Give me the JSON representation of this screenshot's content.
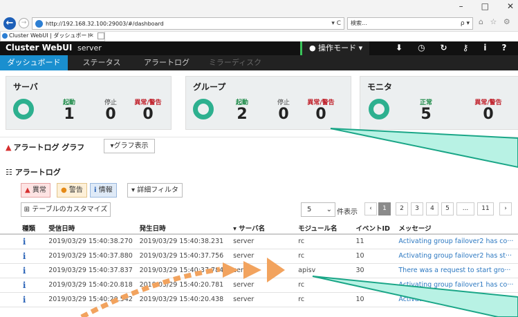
{
  "browser": {
    "url": "http://192.168.32.100:29003/#/dashboard",
    "search_placeholder": "検索...",
    "tab_title": "Cluster WebUI | ダッシュボード",
    "win_controls": [
      "–",
      "□",
      "✕"
    ],
    "refresh_glyph": "▾ C",
    "search_glyph": "ρ ▾",
    "tool_glyphs": "⌂ ☆ ⚙",
    "tab_close": "✕"
  },
  "app": {
    "title": "Cluster WebUI",
    "server": "server",
    "operation_mode": "操作モード ▾",
    "menu": [
      "ダッシュボード",
      "ステータス",
      "アラートログ",
      "ミラーディスク"
    ],
    "header_icons": [
      "download-icon",
      "clock-icon",
      "reload-icon",
      "key-icon",
      "info-icon",
      "help-icon",
      "list-icon"
    ],
    "header_icon_glyphs": [
      "⬇",
      "◷",
      "↻",
      "⚷",
      "i",
      "?",
      "☰"
    ]
  },
  "summary": {
    "server": {
      "title": "サーバ",
      "labels": [
        "起動",
        "停止",
        "異常/警告"
      ],
      "values": [
        "1",
        "0",
        "0"
      ]
    },
    "group": {
      "title": "グループ",
      "labels": [
        "起動",
        "停止",
        "異常/警告"
      ],
      "values": [
        "2",
        "0",
        "0"
      ]
    },
    "monitor": {
      "title": "モニタ",
      "labels": [
        "正常",
        "異常/警告"
      ],
      "values": [
        "5",
        "0"
      ]
    }
  },
  "graph": {
    "title": "アラートログ グラフ",
    "toggle": "▾グラフ表示",
    "warn_glyph": "▲"
  },
  "alertlog": {
    "title": "アラートログ",
    "title_glyph": "☷",
    "filters": [
      {
        "label": "異常",
        "glyph": "▲"
      },
      {
        "label": "警告",
        "glyph": "●"
      },
      {
        "label": "情報",
        "glyph": "i"
      }
    ],
    "detail_filter": "▾ 詳細フィルタ",
    "customize": "テーブルのカスタマイズ",
    "customize_glyph": "⊞",
    "page_size": "5",
    "page_size_glyph": "⌄",
    "page_size_suffix": "件表示",
    "pages": [
      "‹",
      "1",
      "2",
      "3",
      "4",
      "5",
      "...",
      "11",
      "›"
    ],
    "columns": [
      "種類",
      "受信日時",
      "発生日時",
      "▾ サーバ名",
      "モジュール名",
      "イベントID",
      "メッセージ"
    ],
    "rows": [
      {
        "kind": "i",
        "received": "2019/03/29 15:40:38.270",
        "occurred": "2019/03/29 15:40:38.231",
        "server": "server",
        "module": "rc",
        "event": "11",
        "message": "Activating group failover2 has co···"
      },
      {
        "kind": "i",
        "received": "2019/03/29 15:40:37.880",
        "occurred": "2019/03/29 15:40:37.756",
        "server": "server",
        "module": "rc",
        "event": "10",
        "message": "Activating group failover2 has st···"
      },
      {
        "kind": "i",
        "received": "2019/03/29 15:40:37.837",
        "occurred": "2019/03/29 15:40:37.784",
        "server": "server",
        "module": "apisv",
        "event": "30",
        "message": "There was a request to start gro···"
      },
      {
        "kind": "i",
        "received": "2019/03/29 15:40:20.818",
        "occurred": "2019/03/29 15:40:20.781",
        "server": "server",
        "module": "rc",
        "event": "11",
        "message": "Activating group failover1 has co···"
      },
      {
        "kind": "i",
        "received": "2019/03/29 15:40:20.542",
        "occurred": "2019/03/29 15:40:20.438",
        "server": "server",
        "module": "rc",
        "event": "10",
        "message": "Activating group failover1 has st···"
      }
    ]
  },
  "colors": {
    "accent": "#1a8fcf",
    "ok_ring": "#2db08f",
    "callout": "#b8f2e4",
    "arrow": "#f2a35e"
  }
}
